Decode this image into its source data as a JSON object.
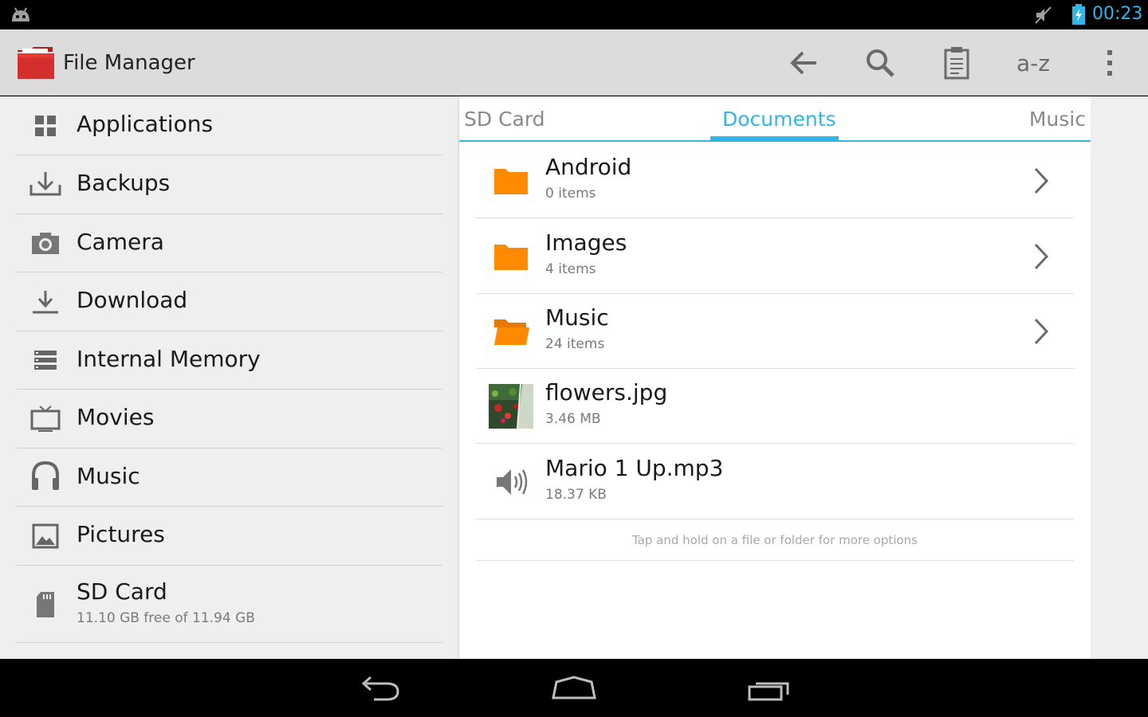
{
  "status_bar": {
    "time": "00:23",
    "icons": [
      "android-icon",
      "mute-icon",
      "battery-charging-icon"
    ]
  },
  "action_bar": {
    "title": "File Manager",
    "logo_icon": "red-folder-icon",
    "actions": [
      {
        "name": "back-arrow-icon"
      },
      {
        "name": "search-icon"
      },
      {
        "name": "clipboard-icon"
      },
      {
        "name": "sort",
        "label": "a-z"
      },
      {
        "name": "overflow-menu-icon"
      }
    ]
  },
  "sidebar": {
    "items": [
      {
        "label": "Applications",
        "icon": "grid-icon"
      },
      {
        "label": "Backups",
        "icon": "backup-download-icon"
      },
      {
        "label": "Camera",
        "icon": "camera-icon"
      },
      {
        "label": "Download",
        "icon": "download-icon"
      },
      {
        "label": "Internal Memory",
        "icon": "storage-icon"
      },
      {
        "label": "Movies",
        "icon": "tv-icon"
      },
      {
        "label": "Music",
        "icon": "headphones-icon"
      },
      {
        "label": "Pictures",
        "icon": "picture-icon"
      },
      {
        "label": "SD Card",
        "sub": "11.10 GB free of 11.94 GB",
        "icon": "sd-card-icon"
      }
    ]
  },
  "content": {
    "tabs": {
      "left": "SD Card",
      "active": "Documents",
      "right": "Music"
    },
    "files": [
      {
        "name": "Android",
        "meta": "0 items",
        "icon": "folder-icon"
      },
      {
        "name": "Images",
        "meta": "4 items",
        "icon": "folder-icon"
      },
      {
        "name": "Music",
        "meta": "24 items",
        "icon": "folder-open-icon"
      },
      {
        "name": "flowers.jpg",
        "meta": "3.46 MB",
        "icon": "image-thumbnail"
      },
      {
        "name": "Mario 1 Up.mp3",
        "meta": "18.37 KB",
        "icon": "speaker-icon"
      }
    ],
    "hint": "Tap and hold on a file or folder for more options"
  },
  "colors": {
    "accent": "#33b5e5",
    "folder": "#ff8a00",
    "logo": "#d32f2f"
  }
}
